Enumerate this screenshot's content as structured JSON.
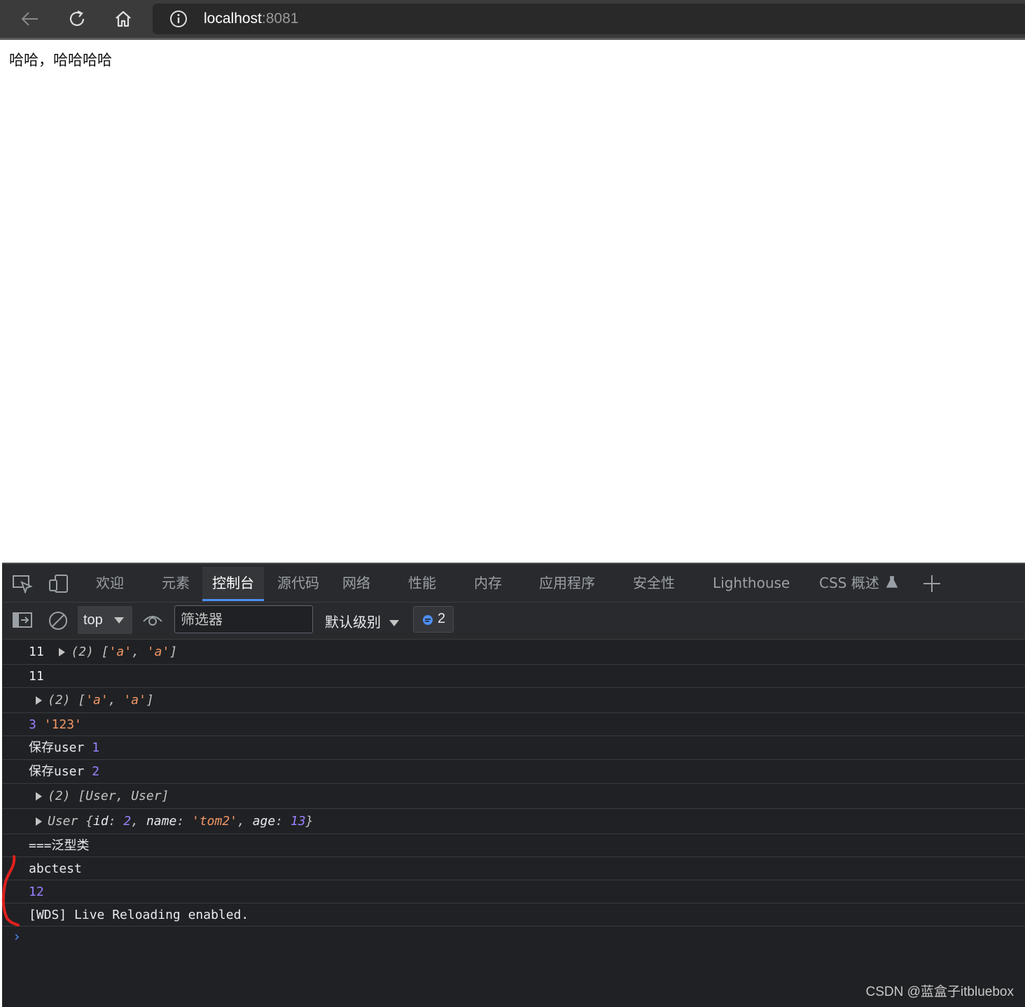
{
  "browser": {
    "url_host": "localhost",
    "url_port": ":8081"
  },
  "page": {
    "text": "哈哈，哈哈哈哈"
  },
  "devtools": {
    "tabs": [
      "欢迎",
      "元素",
      "控制台",
      "源代码",
      "网络",
      "性能",
      "内存",
      "应用程序",
      "安全性",
      "Lighthouse",
      "CSS 概述"
    ],
    "active_tab": "控制台",
    "context": "top",
    "filter_placeholder": "筛选器",
    "log_level": "默认级别",
    "issues_count": "2"
  },
  "console": {
    "rows": [
      {
        "prefix": "11",
        "expandable": true,
        "parts": [
          "(2) [",
          "'a'",
          ", ",
          "'a'",
          "]"
        ]
      },
      {
        "text": "11"
      },
      {
        "expandable": true,
        "parts": [
          "(2) [",
          "'a'",
          ", ",
          "'a'",
          "]"
        ]
      },
      {
        "num": "3",
        "str": "'123'"
      },
      {
        "text": "保存user",
        "num": "1"
      },
      {
        "text": "保存user",
        "num": "2"
      },
      {
        "expandable": true,
        "text": "(2) [User, User]"
      },
      {
        "expandable": true,
        "object": {
          "class": "User",
          "id_key": "id",
          "id_val": "2",
          "name_key": "name",
          "name_val": "'tom2'",
          "age_key": "age",
          "age_val": "13"
        }
      },
      {
        "text": "===泛型类"
      },
      {
        "text": "abctest"
      },
      {
        "num": "12"
      },
      {
        "text": "[WDS] Live Reloading enabled."
      }
    ]
  },
  "watermark": "CSDN @蓝盒子itbluebox",
  "colors": {
    "accent": "#4d8ff5",
    "string": "#f29766",
    "number": "#9980ff",
    "annotation": "#e0201c"
  }
}
